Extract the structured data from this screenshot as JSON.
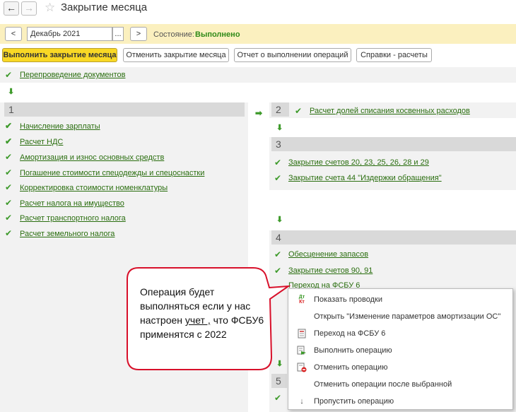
{
  "header": {
    "back_icon": "arrow-left",
    "forward_icon": "arrow-right",
    "star_icon": "star",
    "title": "Закрытие месяца"
  },
  "period_bar": {
    "prev_label": "<",
    "period_value": "Декабрь 2021",
    "select_label": "...",
    "next_label": ">",
    "state_label": "Состояние:",
    "state_value": "Выполнено"
  },
  "toolbar": {
    "run_label": "Выполнить закрытие месяца",
    "cancel_label": "Отменить закрытие месяца",
    "report_label": "Отчет о выполнении операций",
    "info_label": "Справки - расчеты"
  },
  "top_operation": {
    "label": "Перепроведение документов"
  },
  "group1": {
    "number": "1",
    "items": [
      "Начисление зарплаты",
      "Расчет НДС",
      "Амортизация и износ основных средств",
      "Погашение стоимости спецодежды и спецоснастки",
      "Корректировка стоимости номенклатуры",
      "Расчет налога на имущество",
      "Расчет транспортного налога",
      "Расчет земельного налога"
    ]
  },
  "group2": {
    "number": "2",
    "items": [
      "Расчет долей списания косвенных расходов"
    ]
  },
  "group3": {
    "number": "3",
    "items": [
      "Закрытие счетов 20, 23, 25, 26, 28 и 29",
      "Закрытие счета 44 \"Издержки обращения\""
    ]
  },
  "group4": {
    "number": "4",
    "items": [
      "Обесценение запасов",
      "Закрытие счетов 90, 91",
      "Переход на ФСБУ 6"
    ]
  },
  "group5": {
    "number": "5"
  },
  "context_menu": {
    "items": [
      {
        "label": "Показать проводки",
        "icon": "dt-kt-icon"
      },
      {
        "label": "Открыть \"Изменение параметров амортизации ОС\"",
        "icon": ""
      },
      {
        "label": "Переход на ФСБУ 6",
        "icon": "document-icon"
      },
      {
        "label": "Выполнить операцию",
        "icon": "run-icon"
      },
      {
        "label": "Отменить операцию",
        "icon": "undo-icon"
      },
      {
        "label": "Отменить операции после выбранной",
        "icon": ""
      },
      {
        "label": "Пропустить операцию",
        "icon": "arrow-down-icon"
      }
    ],
    "dt_kt_glyph_top": "Дт",
    "dt_kt_glyph_bottom": "Кт"
  },
  "callout": {
    "line1": "Операция будет",
    "line2": "выполняться если у нас",
    "line3_pre": "настроен ",
    "line3_link": "учет ,",
    "line3_post": " что ФСБУ6",
    "line4": "применятся с 2022"
  },
  "colors": {
    "accent_green": "#2a6e0f",
    "check_green": "#3d9a2a",
    "state_green": "#2f8a18",
    "primary_yellow": "#f9d825",
    "bar_yellow": "#fbf0bf",
    "callout_red": "#d8102a"
  }
}
